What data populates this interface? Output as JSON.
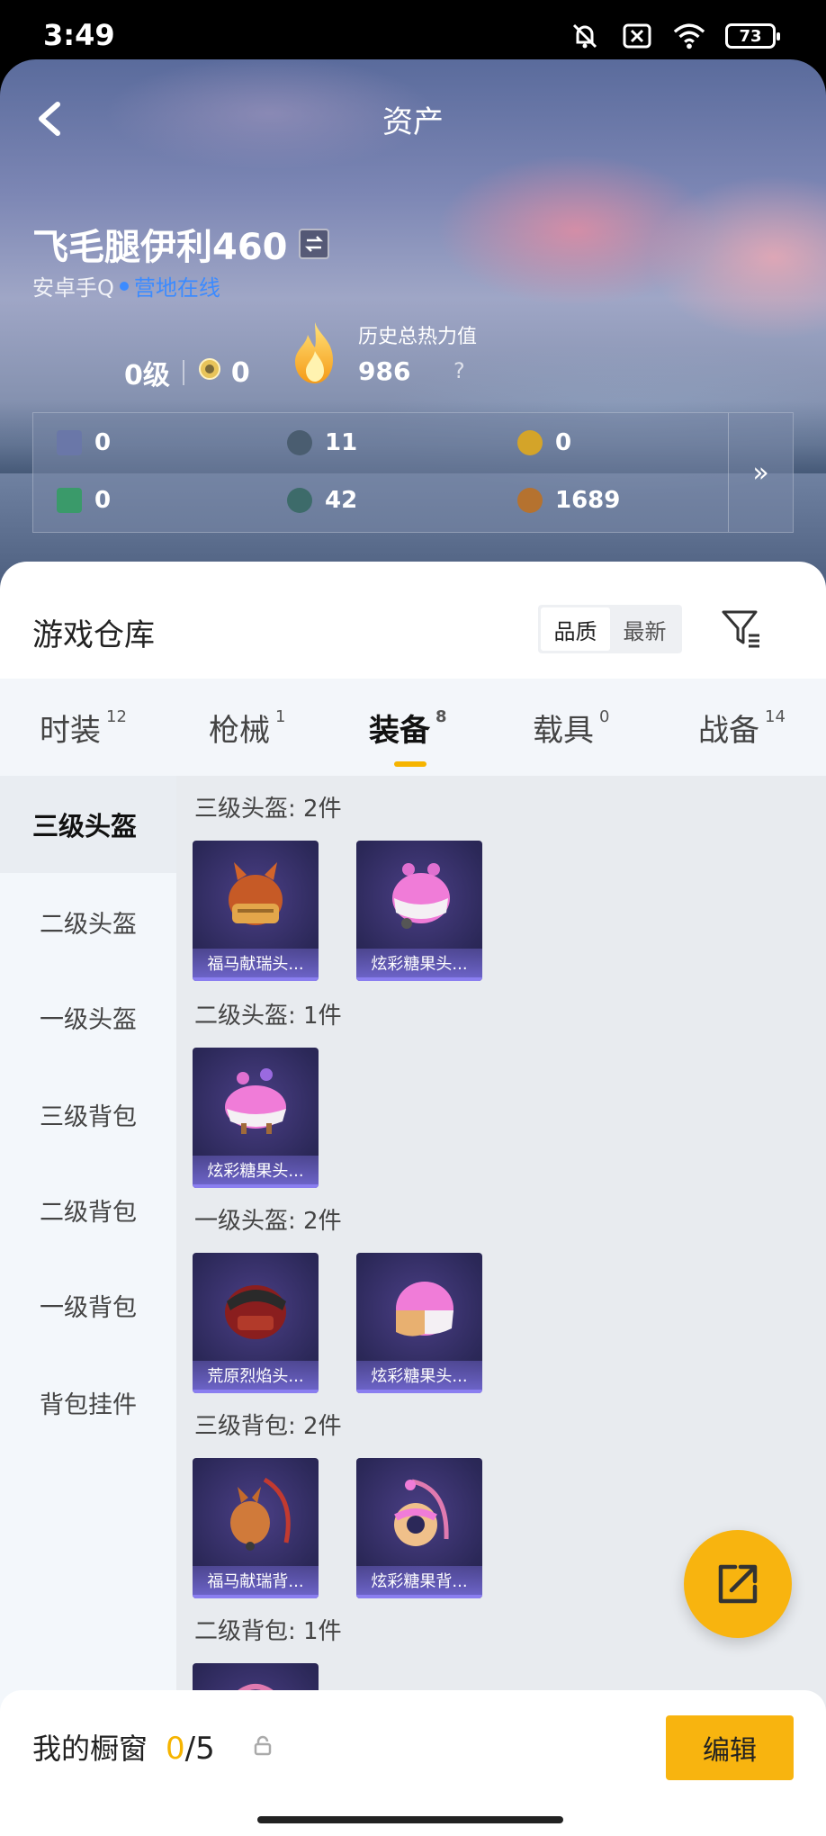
{
  "status_bar": {
    "time": "3:49",
    "battery": "73"
  },
  "header": {
    "title": "资产"
  },
  "profile": {
    "name": "飞毛腿伊利460",
    "platform": "安卓手Q",
    "status": "营地在线",
    "level": "0级",
    "rank_points": "0",
    "heat_label": "历史总热力值",
    "heat_value": "986",
    "heat_help": "?"
  },
  "stats": {
    "items": [
      {
        "icon": "card-icon",
        "value": "0",
        "color": "#6a77a8"
      },
      {
        "icon": "coupon-icon",
        "value": "11",
        "color": "#4a5d70"
      },
      {
        "icon": "gold-coin-icon",
        "value": "0",
        "color": "#d4a429"
      },
      {
        "icon": "green-card-icon",
        "value": "0",
        "color": "#3a9a6a"
      },
      {
        "icon": "gem-icon",
        "value": "42",
        "color": "#3d6b6a"
      },
      {
        "icon": "bronze-coin-icon",
        "value": "1689",
        "color": "#b5722f"
      }
    ],
    "more": "»"
  },
  "warehouse": {
    "title": "游戏仓库",
    "sort_options": [
      "品质",
      "最新"
    ],
    "sort_active": 0
  },
  "tabs": [
    {
      "label": "时装",
      "count": "12"
    },
    {
      "label": "枪械",
      "count": "1"
    },
    {
      "label": "装备",
      "count": "8",
      "active": true
    },
    {
      "label": "载具",
      "count": "0"
    },
    {
      "label": "战备",
      "count": "14"
    }
  ],
  "sidebar": {
    "items": [
      "三级头盔",
      "二级头盔",
      "一级头盔",
      "三级背包",
      "二级背包",
      "一级背包",
      "背包挂件"
    ],
    "active": 0
  },
  "groups": [
    {
      "title": "三级头盔: 2件",
      "items": [
        {
          "name": "福马献瑞头..."
        },
        {
          "name": "炫彩糖果头..."
        }
      ]
    },
    {
      "title": "二级头盔: 1件",
      "items": [
        {
          "name": "炫彩糖果头..."
        }
      ]
    },
    {
      "title": "一级头盔: 2件",
      "items": [
        {
          "name": "荒原烈焰头..."
        },
        {
          "name": "炫彩糖果头..."
        }
      ]
    },
    {
      "title": "三级背包: 2件",
      "items": [
        {
          "name": "福马献瑞背..."
        },
        {
          "name": "炫彩糖果背..."
        }
      ]
    },
    {
      "title": "二级背包: 1件",
      "items": []
    }
  ],
  "showcase": {
    "label": "我的橱窗",
    "current": "0",
    "total": "/5",
    "edit": "编辑"
  },
  "colors": {
    "accent": "#f8b40f",
    "online": "#3c8bff"
  }
}
